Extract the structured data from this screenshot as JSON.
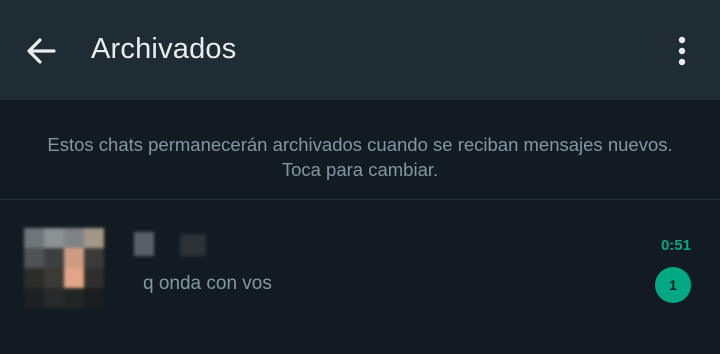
{
  "header": {
    "title": "Archivados",
    "back_icon": "arrow-left-icon",
    "menu_icon": "more-vertical-icon"
  },
  "archive_notice": {
    "text": "Estos chats permanecerán archivados cuando se reciban mensajes nuevos. Toca para cambiar."
  },
  "chats": [
    {
      "name": "",
      "last_message": "q onda con vos",
      "time": "0:51",
      "unread_count": "1"
    }
  ],
  "colors": {
    "accent": "#00a884",
    "background": "#121b22",
    "app_bar": "#1f2c34",
    "primary_text": "#e9edef",
    "secondary_text": "#8696a0"
  }
}
